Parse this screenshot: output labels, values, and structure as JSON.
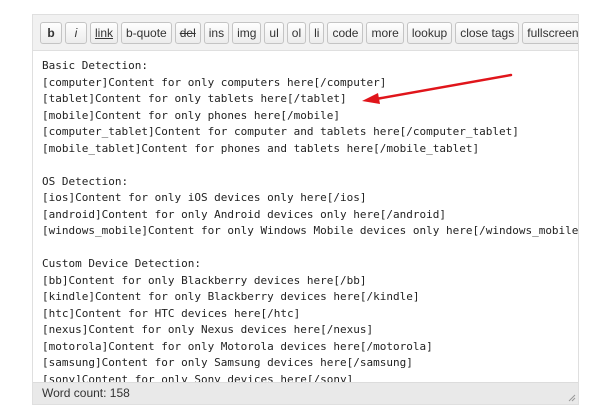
{
  "toolbar": {
    "buttons": [
      {
        "name": "bold-button",
        "label": "b",
        "style": "bold"
      },
      {
        "name": "italic-button",
        "label": "i",
        "style": "ital"
      },
      {
        "name": "link-button",
        "label": "link",
        "style": "link"
      },
      {
        "name": "blockquote-button",
        "label": "b-quote",
        "style": ""
      },
      {
        "name": "delete-button",
        "label": "del",
        "style": "del"
      },
      {
        "name": "insert-button",
        "label": "ins",
        "style": ""
      },
      {
        "name": "image-button",
        "label": "img",
        "style": ""
      },
      {
        "name": "unordered-list-button",
        "label": "ul",
        "style": ""
      },
      {
        "name": "ordered-list-button",
        "label": "ol",
        "style": ""
      },
      {
        "name": "list-item-button",
        "label": "li",
        "style": ""
      },
      {
        "name": "code-button",
        "label": "code",
        "style": ""
      },
      {
        "name": "more-button",
        "label": "more",
        "style": ""
      },
      {
        "name": "lookup-button",
        "label": "lookup",
        "style": ""
      },
      {
        "name": "close-tags-button",
        "label": "close tags",
        "style": ""
      },
      {
        "name": "fullscreen-button",
        "label": "fullscreen",
        "style": ""
      }
    ]
  },
  "content": {
    "lines": [
      "Basic Detection:",
      "[computer]Content for only computers here[/computer]",
      "[tablet]Content for only tablets here[/tablet]",
      "[mobile]Content for only phones here[/mobile]",
      "[computer_tablet]Content for computer and tablets here[/computer_tablet]",
      "[mobile_tablet]Content for phones and tablets here[/mobile_tablet]",
      "",
      "OS Detection:",
      "[ios]Content for only iOS devices only here[/ios]",
      "[android]Content for only Android devices only here[/android]",
      "[windows_mobile]Content for only Windows Mobile devices only here[/windows_mobile]",
      "",
      "Custom Device Detection:",
      "[bb]Content for only Blackberry devices here[/bb]",
      "[kindle]Content for only Blackberry devices here[/kindle]",
      "[htc]Content for HTC devices here[/htc]",
      "[nexus]Content for only Nexus devices here[/nexus]",
      "[motorola]Content for only Motorola devices here[/motorola]",
      "[samsung]Content for only Samsung devices here[/samsung]",
      "[sony]Content for only Sony devices here[/sony]"
    ]
  },
  "status": {
    "word_count": "Word count: 158"
  },
  "colors": {
    "annotation_arrow": "#e0151b"
  }
}
